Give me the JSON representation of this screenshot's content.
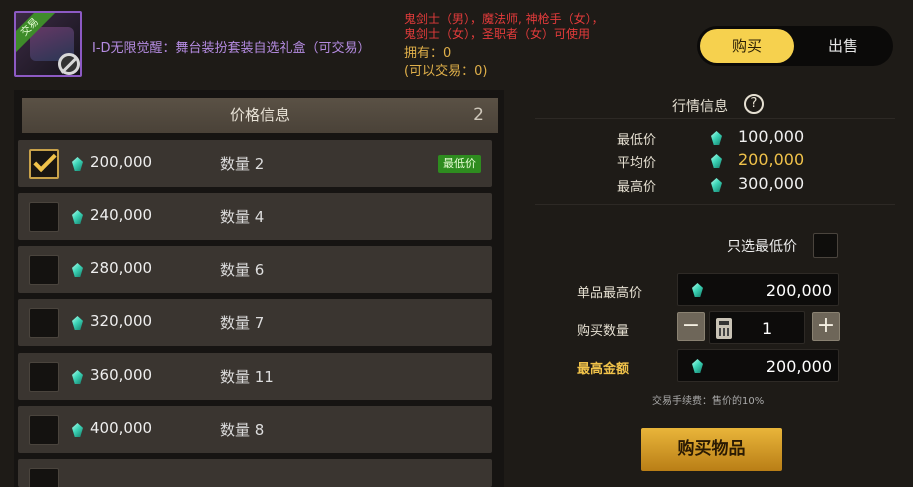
{
  "item": {
    "name": "I-D无限觉醒：舞台装扮套装自选礼盒（可交易）",
    "trade_tag": "交易",
    "job_requirement": "鬼剑士（男），魔法师, 神枪手（女），\n鬼剑士（女），圣职者（女）可使用",
    "owned": "拥有：0",
    "tradable": "(可以交易：0)"
  },
  "tabs": {
    "buy": "购买",
    "sell": "出售",
    "active": "buy"
  },
  "price_panel": {
    "title": "价格信息",
    "count": "2",
    "rows": [
      {
        "price": "200,000",
        "qty": "数量 2",
        "badge": "最低价",
        "checked": true
      },
      {
        "price": "240,000",
        "qty": "数量 4",
        "badge": "",
        "checked": false
      },
      {
        "price": "280,000",
        "qty": "数量 6",
        "badge": "",
        "checked": false
      },
      {
        "price": "320,000",
        "qty": "数量 7",
        "badge": "",
        "checked": false
      },
      {
        "price": "360,000",
        "qty": "数量 11",
        "badge": "",
        "checked": false
      },
      {
        "price": "400,000",
        "qty": "数量 8",
        "badge": "",
        "checked": false
      }
    ]
  },
  "market": {
    "title": "行情信息",
    "help": "?",
    "lowest_label": "最低价",
    "lowest_value": "100,000",
    "average_label": "平均价",
    "average_value": "200,000",
    "highest_label": "最高价",
    "highest_value": "300,000"
  },
  "purchase": {
    "lowest_only_label": "只选最低价",
    "max_unit_price_label": "单品最高价",
    "max_unit_price": "200,000",
    "quantity_label": "购买数量",
    "quantity": "1",
    "minus": "−",
    "plus": "+",
    "max_total_label": "最高金额",
    "max_total": "200,000",
    "fee_note": "交易手续费：售价的10%",
    "buy_button": "购买物品"
  },
  "colors": {
    "accent": "#f6d14e",
    "badge_green": "#2e8c1f",
    "warning_red": "#e33b3b",
    "item_purple": "#b48be0"
  }
}
